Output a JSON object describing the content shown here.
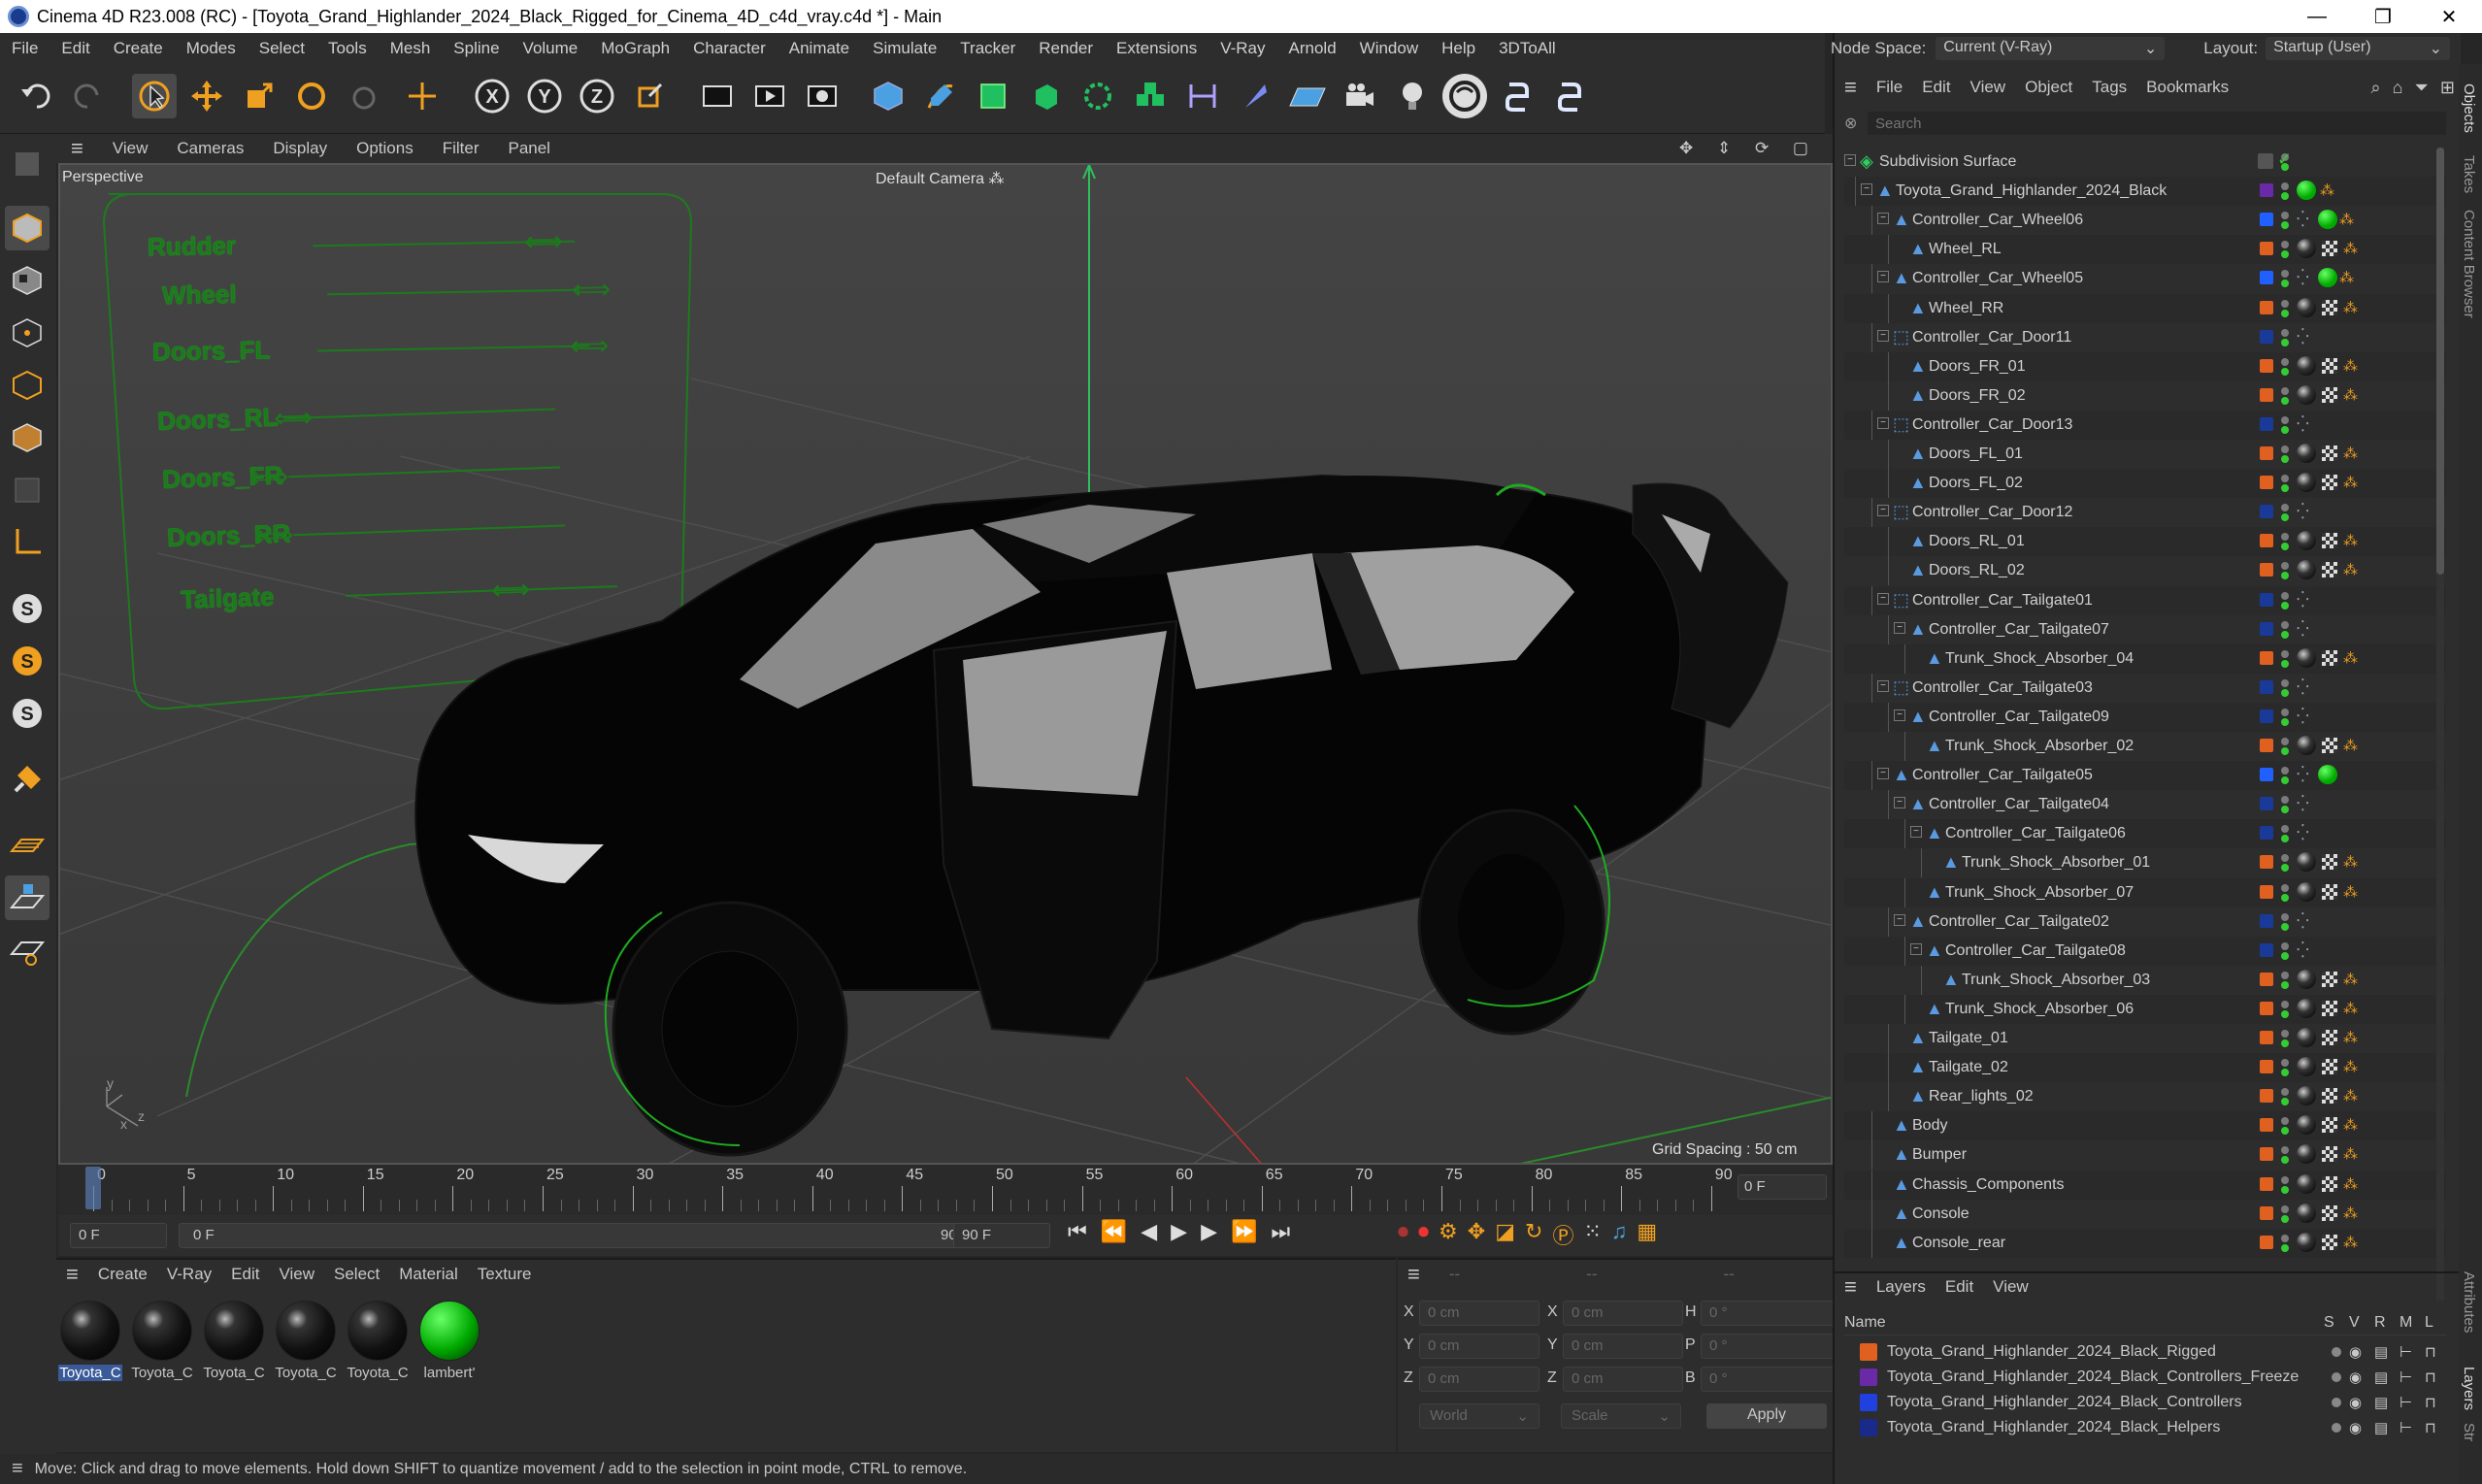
{
  "window": {
    "title": "Cinema 4D R23.008 (RC) - [Toyota_Grand_Highlander_2024_Black_Rigged_for_Cinema_4D_c4d_vray.c4d *] - Main",
    "minimize": "—",
    "maximize": "❐",
    "close": "✕"
  },
  "menu": [
    "File",
    "Edit",
    "Create",
    "Modes",
    "Select",
    "Tools",
    "Mesh",
    "Spline",
    "Volume",
    "MoGraph",
    "Character",
    "Animate",
    "Simulate",
    "Tracker",
    "Render",
    "Extensions",
    "V-Ray",
    "Arnold",
    "Window",
    "Help",
    "3DToAll"
  ],
  "nodespace": {
    "label": "Node Space:",
    "value": "Current (V-Ray)"
  },
  "layout": {
    "label": "Layout:",
    "value": "Startup (User)"
  },
  "viewport_menu": [
    "View",
    "Cameras",
    "Display",
    "Options",
    "Filter",
    "Panel"
  ],
  "viewport": {
    "name": "Perspective",
    "camera": "Default Camera",
    "grid": "Grid Spacing : 50 cm",
    "axis_y": "y",
    "axis_z": "z",
    "axis_x": "x"
  },
  "rig_controls": [
    "Rudder",
    "Wheel",
    "Doors_FL",
    "Doors_RL",
    "Doors_FR",
    "Doors_RR",
    "Tailgate"
  ],
  "timeline": {
    "ticks": [
      "0",
      "5",
      "10",
      "15",
      "20",
      "25",
      "30",
      "35",
      "40",
      "45",
      "50",
      "55",
      "60",
      "65",
      "70",
      "75",
      "80",
      "85",
      "90"
    ],
    "current_frame": "0 F"
  },
  "transport": {
    "start": "0 F",
    "range_start": "0 F",
    "range_end": "90 F",
    "end": "90 F"
  },
  "objects_menu": [
    "File",
    "Edit",
    "View",
    "Object",
    "Tags",
    "Bookmarks"
  ],
  "search_placeholder": "Search",
  "objects": [
    {
      "name": "Subdivision Surface",
      "indent": 0,
      "color": "#3a3a3a"
    },
    {
      "name": "Toyota_Grand_Highlander_2024_Black",
      "indent": 1,
      "color": "#6a2aa8"
    },
    {
      "name": "Controller_Car_Wheel06",
      "indent": 2,
      "color": "#2060ff"
    },
    {
      "name": "Wheel_RL",
      "indent": 3,
      "color": "#e06020"
    },
    {
      "name": "Controller_Car_Wheel05",
      "indent": 2,
      "color": "#2060ff"
    },
    {
      "name": "Wheel_RR",
      "indent": 3,
      "color": "#e06020"
    },
    {
      "name": "Controller_Car_Door11",
      "indent": 2,
      "color": "#1a3a9a"
    },
    {
      "name": "Doors_FR_01",
      "indent": 3,
      "color": "#e06020"
    },
    {
      "name": "Doors_FR_02",
      "indent": 3,
      "color": "#e06020"
    },
    {
      "name": "Controller_Car_Door13",
      "indent": 2,
      "color": "#1a3a9a"
    },
    {
      "name": "Doors_FL_01",
      "indent": 3,
      "color": "#e06020"
    },
    {
      "name": "Doors_FL_02",
      "indent": 3,
      "color": "#e06020"
    },
    {
      "name": "Controller_Car_Door12",
      "indent": 2,
      "color": "#1a3a9a"
    },
    {
      "name": "Doors_RL_01",
      "indent": 3,
      "color": "#e06020"
    },
    {
      "name": "Doors_RL_02",
      "indent": 3,
      "color": "#e06020"
    },
    {
      "name": "Controller_Car_Tailgate01",
      "indent": 2,
      "color": "#1a3a9a"
    },
    {
      "name": "Controller_Car_Tailgate07",
      "indent": 3,
      "color": "#1a3a9a"
    },
    {
      "name": "Trunk_Shock_Absorber_04",
      "indent": 4,
      "color": "#e06020"
    },
    {
      "name": "Controller_Car_Tailgate03",
      "indent": 2,
      "color": "#1a3a9a"
    },
    {
      "name": "Controller_Car_Tailgate09",
      "indent": 3,
      "color": "#1a3a9a"
    },
    {
      "name": "Trunk_Shock_Absorber_02",
      "indent": 4,
      "color": "#e06020"
    },
    {
      "name": "Controller_Car_Tailgate05",
      "indent": 2,
      "color": "#2060ff"
    },
    {
      "name": "Controller_Car_Tailgate04",
      "indent": 3,
      "color": "#1a3a9a"
    },
    {
      "name": "Controller_Car_Tailgate06",
      "indent": 4,
      "color": "#1a3a9a"
    },
    {
      "name": "Trunk_Shock_Absorber_01",
      "indent": 5,
      "color": "#e06020"
    },
    {
      "name": "Trunk_Shock_Absorber_07",
      "indent": 4,
      "color": "#e06020"
    },
    {
      "name": "Controller_Car_Tailgate02",
      "indent": 3,
      "color": "#1a3a9a"
    },
    {
      "name": "Controller_Car_Tailgate08",
      "indent": 4,
      "color": "#1a3a9a"
    },
    {
      "name": "Trunk_Shock_Absorber_03",
      "indent": 5,
      "color": "#e06020"
    },
    {
      "name": "Trunk_Shock_Absorber_06",
      "indent": 4,
      "color": "#e06020"
    },
    {
      "name": "Tailgate_01",
      "indent": 3,
      "color": "#e06020"
    },
    {
      "name": "Tailgate_02",
      "indent": 3,
      "color": "#e06020"
    },
    {
      "name": "Rear_lights_02",
      "indent": 3,
      "color": "#e06020"
    },
    {
      "name": "Body",
      "indent": 2,
      "color": "#e06020"
    },
    {
      "name": "Bumper",
      "indent": 2,
      "color": "#e06020"
    },
    {
      "name": "Chassis_Components",
      "indent": 2,
      "color": "#e06020"
    },
    {
      "name": "Console",
      "indent": 2,
      "color": "#e06020"
    },
    {
      "name": "Console_rear",
      "indent": 2,
      "color": "#e06020"
    }
  ],
  "layers_menu": [
    "Layers",
    "Edit",
    "View"
  ],
  "layers_header": {
    "name": "Name",
    "s": "S",
    "v": "V",
    "r": "R",
    "m": "M",
    "l": "L"
  },
  "layers": [
    {
      "name": "Toyota_Grand_Highlander_2024_Black_Rigged",
      "color": "#e06020"
    },
    {
      "name": "Toyota_Grand_Highlander_2024_Black_Controllers_Freeze",
      "color": "#6a2aa8"
    },
    {
      "name": "Toyota_Grand_Highlander_2024_Black_Controllers",
      "color": "#2040e0"
    },
    {
      "name": "Toyota_Grand_Highlander_2024_Black_Helpers",
      "color": "#1a2a8a"
    }
  ],
  "material_menu": [
    "Create",
    "V-Ray",
    "Edit",
    "View",
    "Select",
    "Material",
    "Texture"
  ],
  "materials": [
    {
      "label": "Toyota_C",
      "type": "dark"
    },
    {
      "label": "Toyota_C",
      "type": "dark"
    },
    {
      "label": "Toyota_C",
      "type": "dark"
    },
    {
      "label": "Toyota_C",
      "type": "dark"
    },
    {
      "label": "Toyota_C",
      "type": "dark"
    },
    {
      "label": "lambert'",
      "type": "green"
    }
  ],
  "coords": {
    "header": [
      "--",
      "--",
      "--"
    ],
    "rows": [
      {
        "a": "X",
        "av": "0 cm",
        "b": "X",
        "bv": "0 cm",
        "c": "H",
        "cv": "0 °"
      },
      {
        "a": "Y",
        "av": "0 cm",
        "b": "Y",
        "bv": "0 cm",
        "c": "P",
        "cv": "0 °"
      },
      {
        "a": "Z",
        "av": "0 cm",
        "b": "Z",
        "bv": "0 cm",
        "c": "B",
        "cv": "0 °"
      }
    ],
    "mode1": "World",
    "mode2": "Scale",
    "apply": "Apply"
  },
  "side_tabs": [
    "Objects",
    "Takes",
    "Content Browser",
    "Attributes",
    "Layers",
    "Str"
  ],
  "status": "Move: Click and drag to move elements. Hold down SHIFT to quantize movement / add to the selection in point mode, CTRL to remove."
}
